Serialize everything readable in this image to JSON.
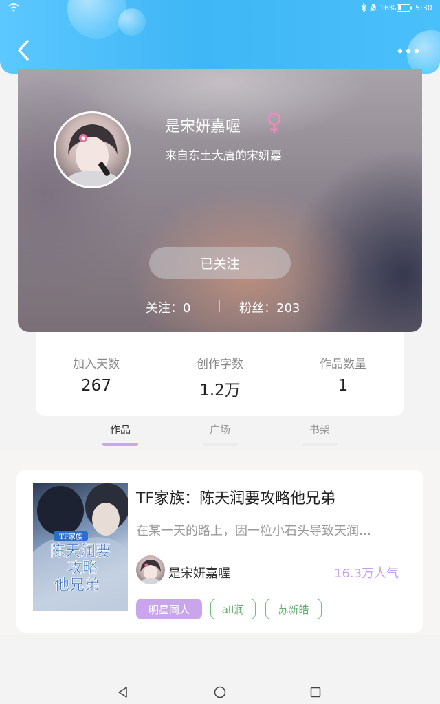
{
  "status_bar": {
    "battery": "16%",
    "time": "5:30"
  },
  "profile": {
    "name": "是宋妍嘉喔",
    "bio": "来自东土大唐的宋妍嘉",
    "follow_button": "已关注",
    "following_label": "关注：0",
    "fans_label": "粉丝：203"
  },
  "stats": [
    {
      "label": "加入天数",
      "value": "267"
    },
    {
      "label": "创作字数",
      "value": "1.2万"
    },
    {
      "label": "作品数量",
      "value": "1"
    }
  ],
  "tabs": [
    {
      "label": "作品",
      "active": true
    },
    {
      "label": "广场",
      "active": false
    },
    {
      "label": "书架",
      "active": false
    }
  ],
  "work": {
    "title": "TF家族：陈天润要攻略他兄弟",
    "description": "在某一天的路上，因一粒小石头导致天润…",
    "author": "是宋妍嘉喔",
    "popularity": "16.3万人气",
    "cover_text": {
      "series": "TF家族",
      "title_line1": "陈天润要",
      "title_line2": "攻略",
      "title_line3": "他兄弟"
    },
    "tags": [
      "明星同人",
      "all润",
      "苏新皓"
    ]
  },
  "colors": {
    "header": "#4ab8f6",
    "accent": "#c7a8e8",
    "tag_purple_bg": "#c9a6ec",
    "tag_green": "#6fbf7a"
  },
  "icons": {
    "back": "back-icon",
    "more": "more-icon",
    "gender": "female-icon"
  }
}
